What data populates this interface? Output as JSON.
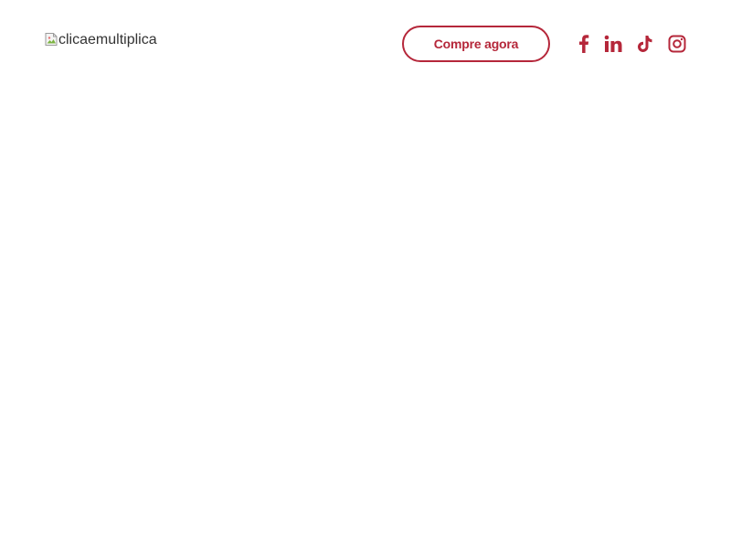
{
  "header": {
    "logo_alt": "clicaemultiplica",
    "cta_label": "Compre agora"
  },
  "social": [
    {
      "name": "facebook",
      "icon": "facebook-icon"
    },
    {
      "name": "linkedin",
      "icon": "linkedin-icon"
    },
    {
      "name": "tiktok",
      "icon": "tiktok-icon"
    },
    {
      "name": "instagram",
      "icon": "instagram-icon"
    }
  ],
  "colors": {
    "accent": "#b5273a",
    "background": "#ffffff",
    "text": "#333333"
  }
}
